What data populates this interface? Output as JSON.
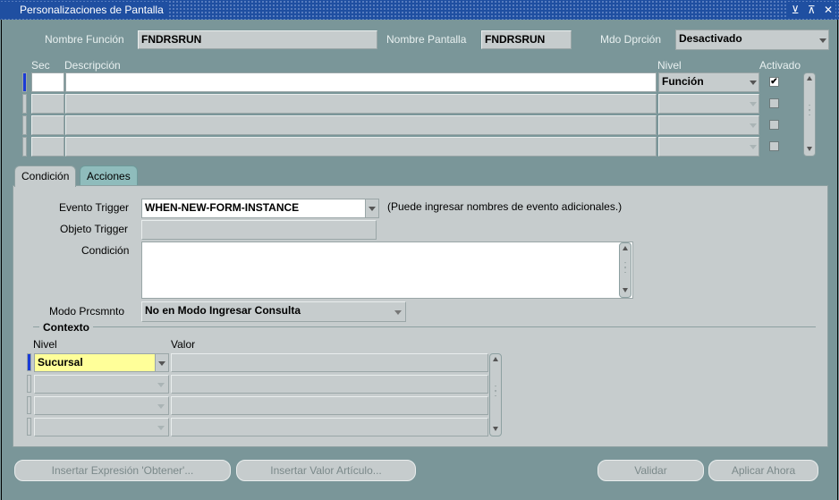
{
  "window": {
    "title": "Personalizaciones de Pantalla",
    "controls": "⊻ ⊼ ✕"
  },
  "header": {
    "function_name_label": "Nombre Función",
    "function_name_value": "FNDRSRUN",
    "form_name_label": "Nombre Pantalla",
    "form_name_value": "FNDRSRUN",
    "debug_mode_label": "Mdo Dprción",
    "debug_mode_value": "Desactivado"
  },
  "grid": {
    "columns": {
      "seq": "Sec",
      "description": "Descripción",
      "level": "Nivel",
      "enabled": "Activado"
    },
    "rows": [
      {
        "seq": "",
        "description": "",
        "level": "Función",
        "enabled": "✔"
      },
      {
        "seq": "",
        "description": "",
        "level": "",
        "enabled": ""
      },
      {
        "seq": "",
        "description": "",
        "level": "",
        "enabled": ""
      },
      {
        "seq": "",
        "description": "",
        "level": "",
        "enabled": ""
      }
    ]
  },
  "tabs": {
    "condition": "Condición",
    "actions": "Acciones"
  },
  "condition": {
    "trigger_event_label": "Evento Trigger",
    "trigger_event_value": "WHEN-NEW-FORM-INSTANCE",
    "trigger_event_hint": "(Puede ingresar nombres de evento adicionales.)",
    "trigger_object_label": "Objeto Trigger",
    "trigger_object_value": "",
    "condition_label": "Condición",
    "condition_value": "",
    "processing_mode_label": "Modo Prcsmnto",
    "processing_mode_value": "No en Modo Ingresar Consulta"
  },
  "context": {
    "title": "Contexto",
    "level_header": "Nivel",
    "value_header": "Valor",
    "rows": [
      {
        "level": "Sucursal",
        "value": ""
      },
      {
        "level": "",
        "value": ""
      },
      {
        "level": "",
        "value": ""
      },
      {
        "level": "",
        "value": ""
      }
    ]
  },
  "buttons": {
    "insert_get_expression": "Insertar Expresión 'Obtener'...",
    "insert_item_value": "Insertar Valor Artículo...",
    "validate": "Validar",
    "apply_now": "Aplicar Ahora"
  }
}
